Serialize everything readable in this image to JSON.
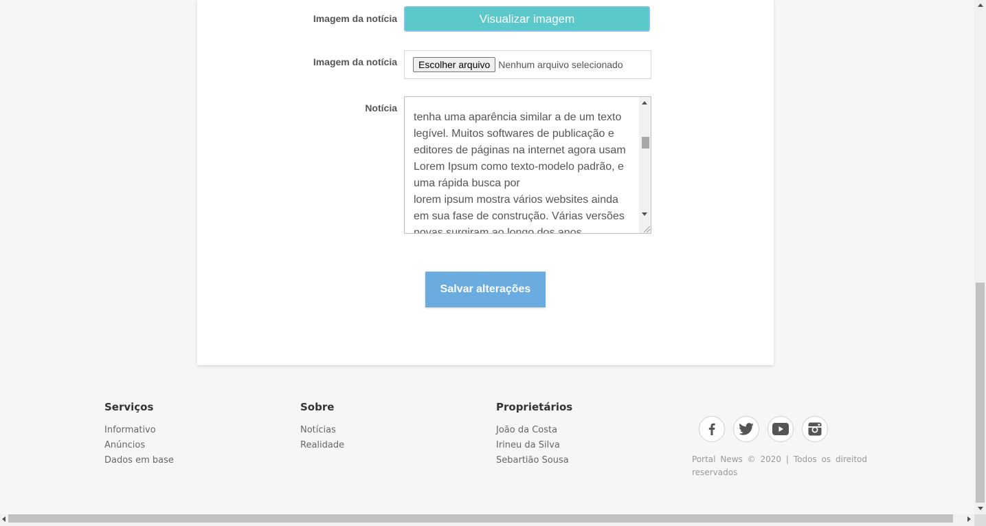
{
  "form": {
    "image_view_label": "Imagem da notícia",
    "view_image_button": "Visualizar imagem",
    "image_upload_label": "Imagem da notícia",
    "file_button": "Escolher arquivo",
    "file_status": "Nenhum arquivo selecionado",
    "news_label": "Notícia",
    "news_text_lines": [
      "tenha uma aparência similar a de um texto",
      "legível. Muitos softwares de publicação e",
      "editores de páginas na internet agora usam",
      "Lorem Ipsum como texto-modelo padrão, e",
      "uma rápida busca por",
      "lorem ipsum mostra vários websites ainda",
      "em sua fase de construção. Várias versões",
      "novas surgiram ao longo dos anos,"
    ],
    "save_button": "Salvar alterações"
  },
  "footer": {
    "columns": [
      {
        "title": "Serviços",
        "links": [
          "Informativo",
          "Anúncios",
          "Dados em base"
        ]
      },
      {
        "title": "Sobre",
        "links": [
          "Notícias",
          "Realidade"
        ]
      },
      {
        "title": "Proprietários",
        "links": [
          "João da Costa",
          "Irineu da Silva",
          "Sebartião Sousa"
        ]
      }
    ],
    "social": [
      "facebook-icon",
      "twitter-icon",
      "youtube-icon",
      "instagram-icon"
    ],
    "copyright": "Portal News © 2020 | Todos os direitod reservados"
  },
  "colors": {
    "view_button": "#5bc8c9",
    "save_button": "#6aace0",
    "page_background": "#f6f6f6"
  }
}
